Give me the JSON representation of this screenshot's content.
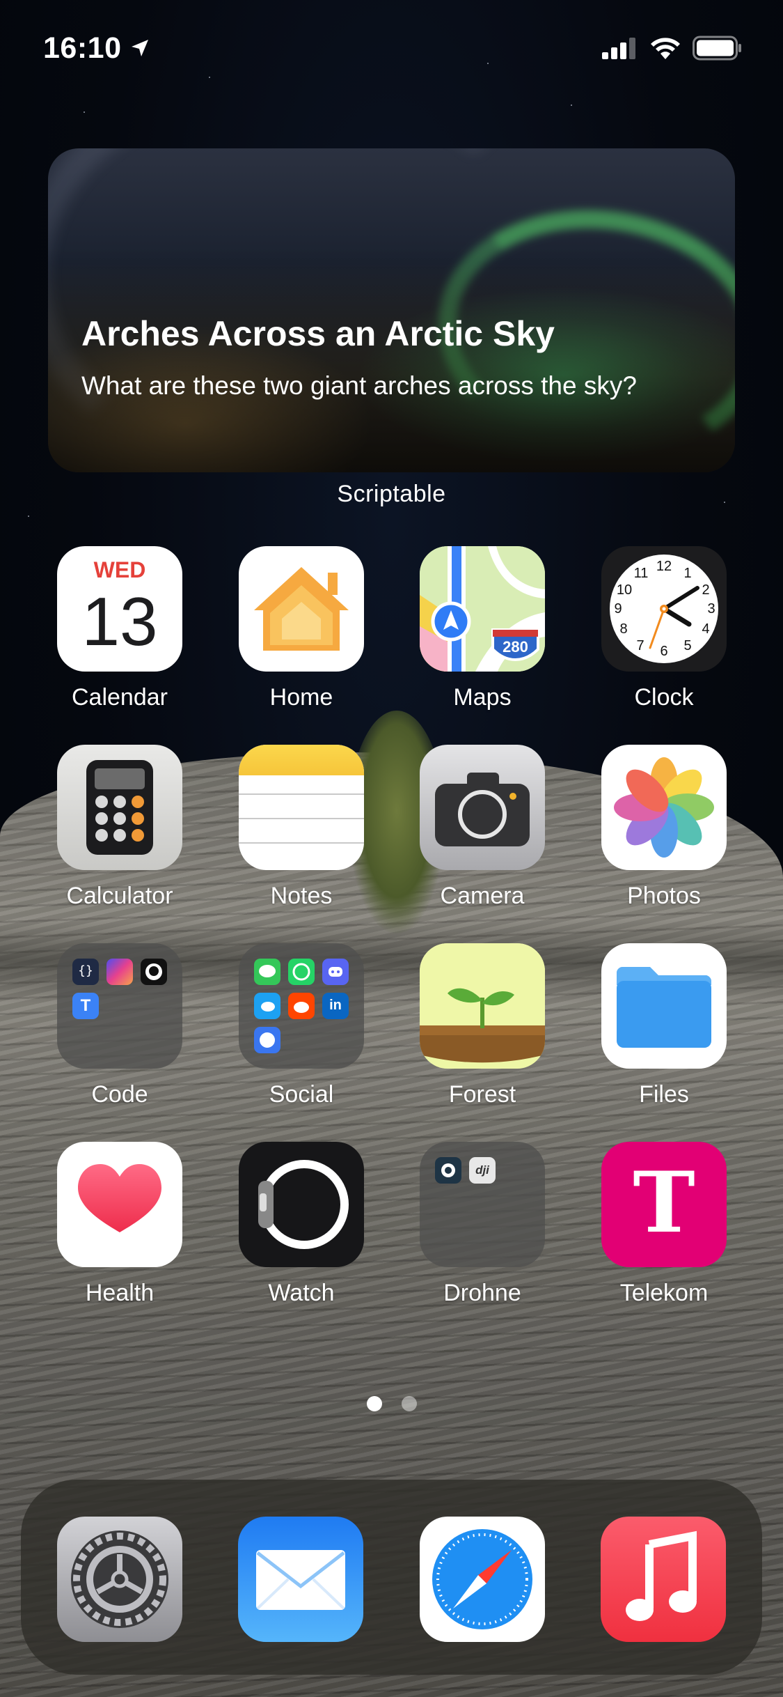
{
  "status_bar": {
    "time": "16:10"
  },
  "widget": {
    "title": "Arches Across an Arctic Sky",
    "subtitle": "What are these two giant arches across the sky?",
    "app_label": "Scriptable"
  },
  "apps": {
    "calendar": {
      "label": "Calendar",
      "weekday": "WED",
      "day": "13"
    },
    "home": {
      "label": "Home"
    },
    "maps": {
      "label": "Maps",
      "shield": "280"
    },
    "clock": {
      "label": "Clock",
      "numbers": [
        "12",
        "1",
        "2",
        "3",
        "4",
        "5",
        "6",
        "7",
        "8",
        "9",
        "10",
        "11"
      ]
    },
    "calculator": {
      "label": "Calculator"
    },
    "notes": {
      "label": "Notes"
    },
    "camera": {
      "label": "Camera"
    },
    "photos": {
      "label": "Photos"
    },
    "code": {
      "label": "Code",
      "mini_letter": "T"
    },
    "social": {
      "label": "Social",
      "linkedin": "in"
    },
    "forest": {
      "label": "Forest"
    },
    "files": {
      "label": "Files"
    },
    "health": {
      "label": "Health"
    },
    "watch": {
      "label": "Watch"
    },
    "drohne": {
      "label": "Drohne",
      "dji": "dji"
    },
    "telekom": {
      "label": "Telekom",
      "letter": "T"
    }
  },
  "page_indicator": {
    "pages": 2,
    "current": 1
  },
  "dock": [
    "settings-icon",
    "mail-icon",
    "safari-icon",
    "music-icon"
  ],
  "colors": {
    "calendar_red": "#e5413a",
    "telekom_magenta": "#e20074",
    "music_red": "#f24456",
    "mail_blue": "#2a8cf6",
    "files_blue": "#3a9bf0"
  }
}
